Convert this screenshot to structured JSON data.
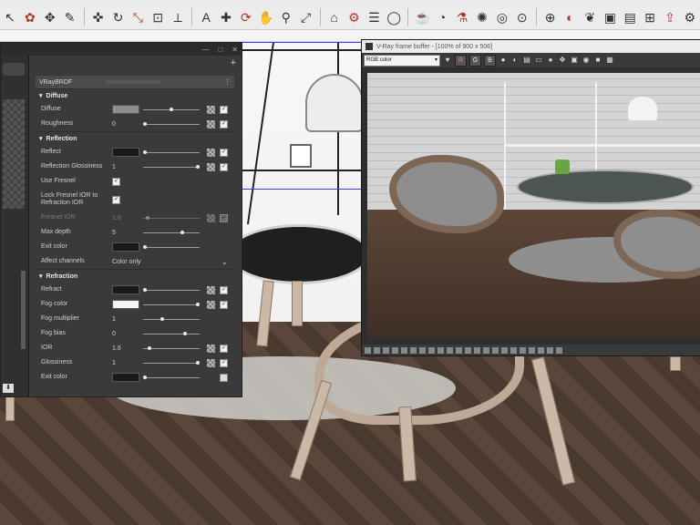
{
  "toolbar": {
    "icons": [
      "select-icon",
      "component-icon",
      "eraser-icon",
      "paint-icon",
      "move-icon",
      "rotate-icon",
      "scale-icon",
      "offset-icon",
      "tape-icon",
      "text-icon",
      "axes-icon",
      "orbit-icon",
      "pan-icon",
      "zoom-icon",
      "zoom-extents-icon",
      "warehouse-icon",
      "extension-icon",
      "layers-icon",
      "sphere-icon",
      "vray-render-icon",
      "vray-interactive-icon",
      "vray-material-icon",
      "vray-light-icon",
      "vray-sphere-light-icon",
      "vray-mesh-light-icon",
      "vray-ies-icon",
      "vray-dome-icon",
      "vray-fur-icon",
      "vray-proxy-icon",
      "vray-frame-buffer-icon",
      "vray-clipper-icon",
      "vray-export-icon",
      "vray-settings-icon"
    ]
  },
  "panel": {
    "plus": "+",
    "brdf_title": "VRayBRDF",
    "sections": {
      "diffuse": "Diffuse",
      "reflection": "Reflection",
      "refraction": "Refraction"
    },
    "diffuse": {
      "diffuse_label": "Diffuse",
      "roughness_label": "Roughness",
      "roughness_value": "0"
    },
    "reflection": {
      "reflect_label": "Reflect",
      "gloss_label": "Reflection Glossiness",
      "gloss_value": "1",
      "fresnel_label": "Use Fresnel",
      "lock_label": "Lock Fresnel IOR to Refraction IOR",
      "fresnel_ior_label": "Fresnel IOR",
      "fresnel_ior_value": "1.6",
      "depth_label": "Max depth",
      "depth_value": "5",
      "exit_label": "Exit color",
      "affect_label": "Affect channels",
      "affect_value": "Color only"
    },
    "refraction": {
      "refract_label": "Refract",
      "fog_color_label": "Fog color",
      "fog_mult_label": "Fog multiplier",
      "fog_mult_value": "1",
      "fog_bias_label": "Fog bias",
      "fog_bias_value": "0",
      "ior_label": "IOR",
      "ior_value": "1.6",
      "gloss_label": "Glossiness",
      "gloss_value": "1",
      "exit_label": "Exit color"
    },
    "sliders": {
      "roughness": 0.0,
      "reflect_gloss": 1.0,
      "fresnel_ior": 0.05,
      "max_depth": 0.7,
      "exit_color": 0.0,
      "refract": 0.0,
      "fog_color": 1.0,
      "fog_multiplier": 0.33,
      "fog_bias": 0.75,
      "ior": 0.08,
      "glossiness": 1.0,
      "refraction_exit": 0.0
    }
  },
  "vfb": {
    "title": "V-Ray frame buffer - [100% of 900 x 506]",
    "channel_select": "RGB color",
    "channels": [
      "R",
      "G",
      "B"
    ]
  }
}
